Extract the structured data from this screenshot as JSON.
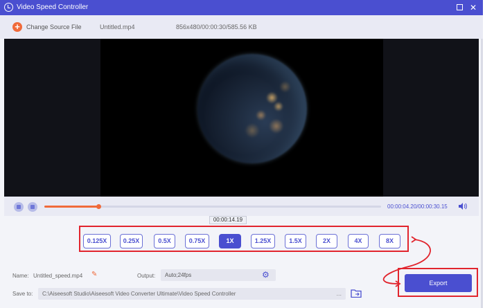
{
  "window": {
    "title": "Video Speed Controller"
  },
  "topbar": {
    "change_source_label": "Change Source File",
    "file_name": "Untitled.mp4",
    "file_info": "856x480/00:00:30/585.56 KB"
  },
  "playback": {
    "time_readout": "00:00:04.20/00:00:30.15",
    "progress_fraction": 0.16,
    "tooltip_time": "00:00:14.19"
  },
  "speeds": {
    "options": [
      "0.125X",
      "0.25X",
      "0.5X",
      "0.75X",
      "1X",
      "1.25X",
      "1.5X",
      "2X",
      "4X",
      "8X"
    ],
    "selected": "1X"
  },
  "output": {
    "name_label": "Name:",
    "name_value": "Untitled_speed.mp4",
    "output_label": "Output:",
    "output_value": "Auto;24fps",
    "save_label": "Save to:",
    "save_path": "C:\\Aiseesoft Studio\\Aiseesoft Video Converter Ultimate\\Video Speed Controller",
    "browse_label": "...",
    "export_label": "Export"
  },
  "colors": {
    "accent": "#4a4fd0",
    "highlight": "#e1242d",
    "orange": "#f06a3a"
  },
  "icons": {
    "app": "speed-controller-icon",
    "add": "plus-circle-icon",
    "edit": "pencil-icon",
    "settings": "gear-icon",
    "folder": "folder-icon",
    "volume": "speaker-icon"
  }
}
